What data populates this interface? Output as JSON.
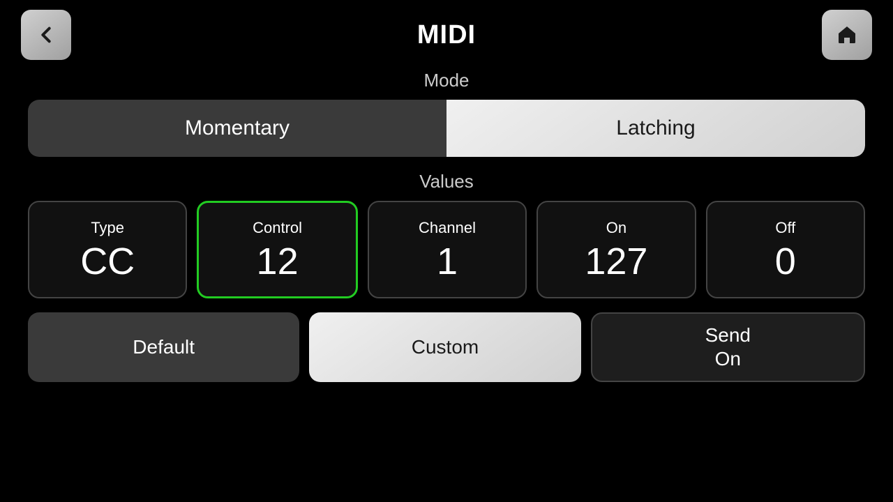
{
  "header": {
    "title": "MIDI",
    "back_label": "Back",
    "home_label": "Home"
  },
  "mode_section": {
    "label": "Mode",
    "buttons": [
      {
        "id": "momentary",
        "label": "Momentary",
        "active": false
      },
      {
        "id": "latching",
        "label": "Latching",
        "active": true
      }
    ]
  },
  "values_section": {
    "label": "Values",
    "cards": [
      {
        "id": "type",
        "label": "Type",
        "value": "CC",
        "selected": false
      },
      {
        "id": "control",
        "label": "Control",
        "value": "12",
        "selected": true
      },
      {
        "id": "channel",
        "label": "Channel",
        "value": "1",
        "selected": false
      },
      {
        "id": "on",
        "label": "On",
        "value": "127",
        "selected": false
      },
      {
        "id": "off",
        "label": "Off",
        "value": "0",
        "selected": false
      }
    ]
  },
  "bottom_section": {
    "buttons": [
      {
        "id": "default",
        "label": "Default",
        "style": "dark"
      },
      {
        "id": "custom",
        "label": "Custom",
        "style": "light"
      },
      {
        "id": "send-on",
        "label_line1": "Send",
        "label_line2": "On",
        "style": "dark-border"
      }
    ]
  }
}
